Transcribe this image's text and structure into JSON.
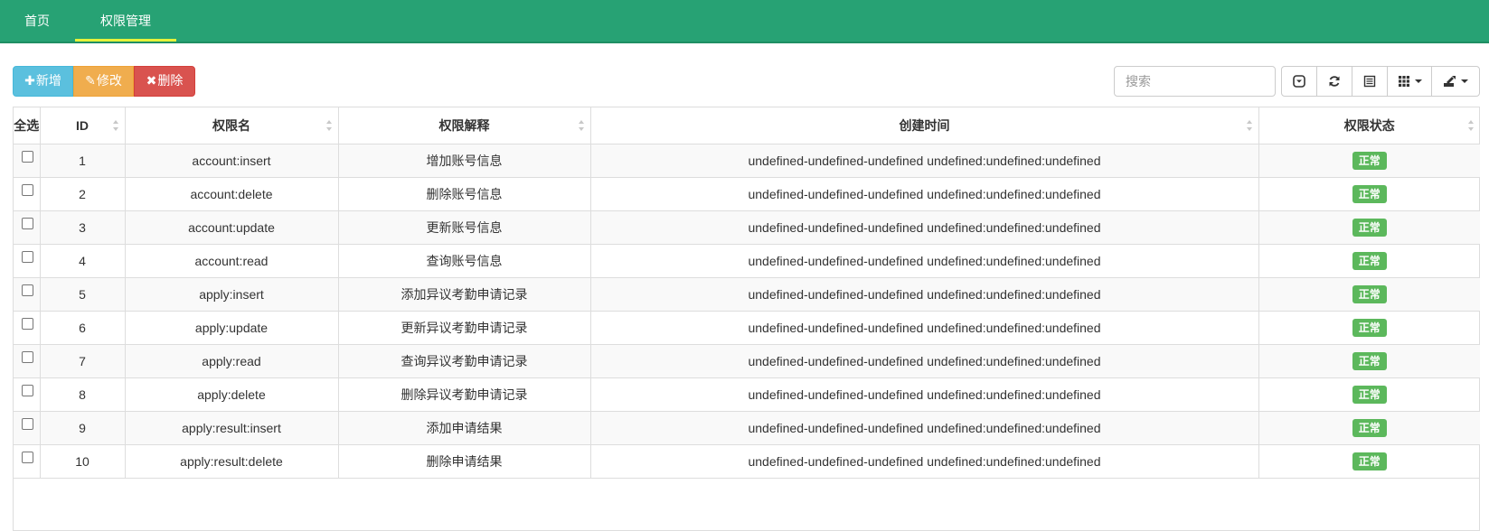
{
  "nav": {
    "tabs": [
      {
        "label": "首页"
      },
      {
        "label": "权限管理"
      }
    ]
  },
  "toolbar": {
    "add_label": "新增",
    "edit_label": "修改",
    "delete_label": "删除",
    "search_placeholder": "搜索"
  },
  "table": {
    "headers": [
      "全选",
      "ID",
      "权限名",
      "权限解释",
      "创建时间",
      "权限状态"
    ],
    "rows": [
      {
        "id": "1",
        "name": "account:insert",
        "desc": "增加账号信息",
        "created": "undefined-undefined-undefined undefined:undefined:undefined",
        "status": "正常"
      },
      {
        "id": "2",
        "name": "account:delete",
        "desc": "删除账号信息",
        "created": "undefined-undefined-undefined undefined:undefined:undefined",
        "status": "正常"
      },
      {
        "id": "3",
        "name": "account:update",
        "desc": "更新账号信息",
        "created": "undefined-undefined-undefined undefined:undefined:undefined",
        "status": "正常"
      },
      {
        "id": "4",
        "name": "account:read",
        "desc": "查询账号信息",
        "created": "undefined-undefined-undefined undefined:undefined:undefined",
        "status": "正常"
      },
      {
        "id": "5",
        "name": "apply:insert",
        "desc": "添加异议考勤申请记录",
        "created": "undefined-undefined-undefined undefined:undefined:undefined",
        "status": "正常"
      },
      {
        "id": "6",
        "name": "apply:update",
        "desc": "更新异议考勤申请记录",
        "created": "undefined-undefined-undefined undefined:undefined:undefined",
        "status": "正常"
      },
      {
        "id": "7",
        "name": "apply:read",
        "desc": "查询异议考勤申请记录",
        "created": "undefined-undefined-undefined undefined:undefined:undefined",
        "status": "正常"
      },
      {
        "id": "8",
        "name": "apply:delete",
        "desc": "删除异议考勤申请记录",
        "created": "undefined-undefined-undefined undefined:undefined:undefined",
        "status": "正常"
      },
      {
        "id": "9",
        "name": "apply:result:insert",
        "desc": "添加申请结果",
        "created": "undefined-undefined-undefined undefined:undefined:undefined",
        "status": "正常"
      },
      {
        "id": "10",
        "name": "apply:result:delete",
        "desc": "删除申请结果",
        "created": "undefined-undefined-undefined undefined:undefined:undefined",
        "status": "正常"
      }
    ]
  },
  "colors": {
    "nav_bg": "#27a274",
    "active_underline": "#e5f23a",
    "add": "#5bc0de",
    "edit": "#f0ad4e",
    "delete": "#d9534f",
    "status_ok": "#5cb85c"
  },
  "icons": [
    "plus-icon",
    "pencil-icon",
    "x-icon",
    "toggle-icon",
    "refresh-icon",
    "list-view-icon",
    "columns-icon",
    "export-icon"
  ]
}
